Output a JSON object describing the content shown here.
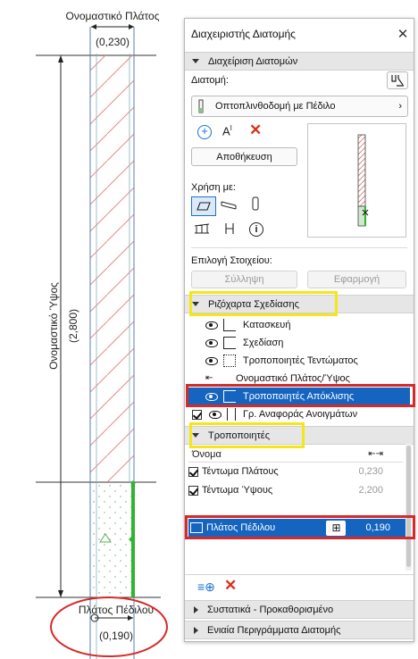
{
  "drawing": {
    "top_dimension_title": "Ονομαστικό Πλάτος",
    "top_dimension_value": "(0,230)",
    "height_title": "Ονομαστικό Ύψος",
    "height_value": "(2,800)",
    "bottom_title": "Πλάτος Πέδιλου",
    "bottom_value": "(0,190)"
  },
  "palette": {
    "title": "Διαχειριστής Διατομής",
    "close_icon": "close-icon",
    "section_manage": "Διαχείριση Διατομών",
    "section_label": "Διατομή:",
    "section_select_value": "Οπτοπλινθοδομή με Πέδιλο",
    "save_button": "Αποθήκευση",
    "usage_label": "Χρήση με:",
    "element_choice_label": "Επιλογή Στοιχείου:",
    "pick_button": "Σύλληψη",
    "apply_button": "Εφαρμογή",
    "drafting_section": "Ριζόχαρτα Σχεδίασης",
    "tree_items": [
      {
        "label": "Κατασκευή",
        "icon": "construction-icon"
      },
      {
        "label": "Σχεδίαση",
        "icon": "drafting-icon"
      },
      {
        "label": "Τροποποιητές Τεντώματος",
        "icon": "stretch-modifier-icon"
      },
      {
        "label": "Ονομαστικό Πλάτος/Ύψος",
        "icon": "nominal-size-icon"
      },
      {
        "label": "Τροποποιητές Απόκλισης",
        "icon": "offset-modifier-icon"
      },
      {
        "label": "Γρ. Αναφοράς Ανοιγμάτων",
        "icon": "opening-reference-icon"
      }
    ],
    "modifiers_section": "Τροποποιητές",
    "modifiers_table": {
      "col_name": "Όνομα",
      "rows": [
        {
          "name": "Τέντωμα Πλάτους",
          "value": "0,230"
        },
        {
          "name": "Τέντωμα Ύψους",
          "value": "2,200"
        }
      ]
    },
    "offset_row": {
      "name": "Πλάτος Πέδιλου",
      "value": "0,190"
    },
    "components_section": "Συστατικά - Προκαθορισμένο",
    "contours_section": "Ενιαία Περιγράμματα Διατομής"
  },
  "colors": {
    "selection": "#1565c0",
    "highlight_yellow": "#f5e61a",
    "highlight_red": "#d62a2a",
    "hatch": "#e06b6b",
    "footing_green": "#2fb52f"
  }
}
